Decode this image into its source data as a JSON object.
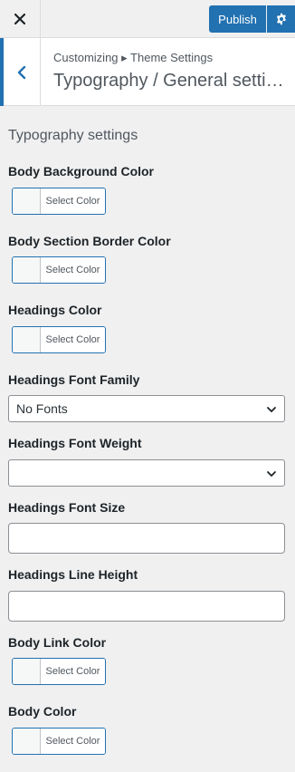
{
  "header": {
    "close_icon": "close-icon",
    "publish_label": "Publish",
    "settings_icon": "gear-icon",
    "accent_color": "#2271b1"
  },
  "section": {
    "breadcrumb": "Customizing ▸ Theme Settings",
    "title": "Typography / General settings",
    "back_icon": "chevron-left-icon"
  },
  "panel": {
    "title": "Typography settings",
    "controls": {
      "body_bg": {
        "label": "Body Background Color",
        "button": "Select Color"
      },
      "section_border": {
        "label": "Body Section Border Color",
        "button": "Select Color"
      },
      "headings_color": {
        "label": "Headings Color",
        "button": "Select Color"
      },
      "font_family": {
        "label": "Headings Font Family",
        "value": "No Fonts"
      },
      "font_weight": {
        "label": "Headings Font Weight",
        "value": ""
      },
      "font_size": {
        "label": "Headings Font Size",
        "value": ""
      },
      "line_height": {
        "label": "Headings Line Height",
        "value": ""
      },
      "link_color": {
        "label": "Body Link Color",
        "button": "Select Color"
      },
      "body_color": {
        "label": "Body Color",
        "button": "Select Color"
      }
    }
  }
}
